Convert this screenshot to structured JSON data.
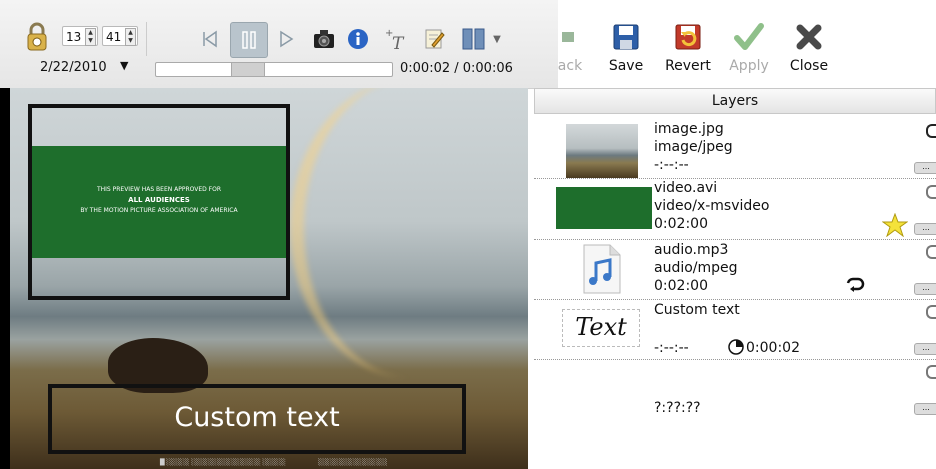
{
  "controls": {
    "spin_hour": "13",
    "spin_minute": "41",
    "date": "2/22/2010",
    "time_readout": "0:00:02 / 0:00:06"
  },
  "toolbar": {
    "back_label": "ack",
    "save_label": "Save",
    "revert_label": "Revert",
    "apply_label": "Apply",
    "close_label": "Close"
  },
  "preview": {
    "text_overlay": "Custom text",
    "video_line1": "THIS PREVIEW HAS BEEN APPROVED FOR",
    "video_line2": "ALL AUDIENCES",
    "video_line3": "BY THE MOTION PICTURE ASSOCIATION OF AMERICA"
  },
  "layers": {
    "header": "Layers",
    "items": [
      {
        "name": "image.jpg",
        "type": "image/jpeg",
        "duration": "-:--:--"
      },
      {
        "name": "video.avi",
        "type": "video/x-msvideo",
        "duration": "0:02:00"
      },
      {
        "name": "audio.mp3",
        "type": "audio/mpeg",
        "duration": "0:02:00"
      },
      {
        "name": "Custom text",
        "type": "",
        "duration": "-:--:--",
        "timer": "0:00:02",
        "thumb_text": "Text"
      },
      {
        "name": "",
        "type": "",
        "duration": "?:??:??"
      }
    ]
  },
  "colors": {
    "selection_dash": "#f2e200",
    "video_green": "#1e6e2c",
    "accent_blue": "#2a64c4"
  }
}
